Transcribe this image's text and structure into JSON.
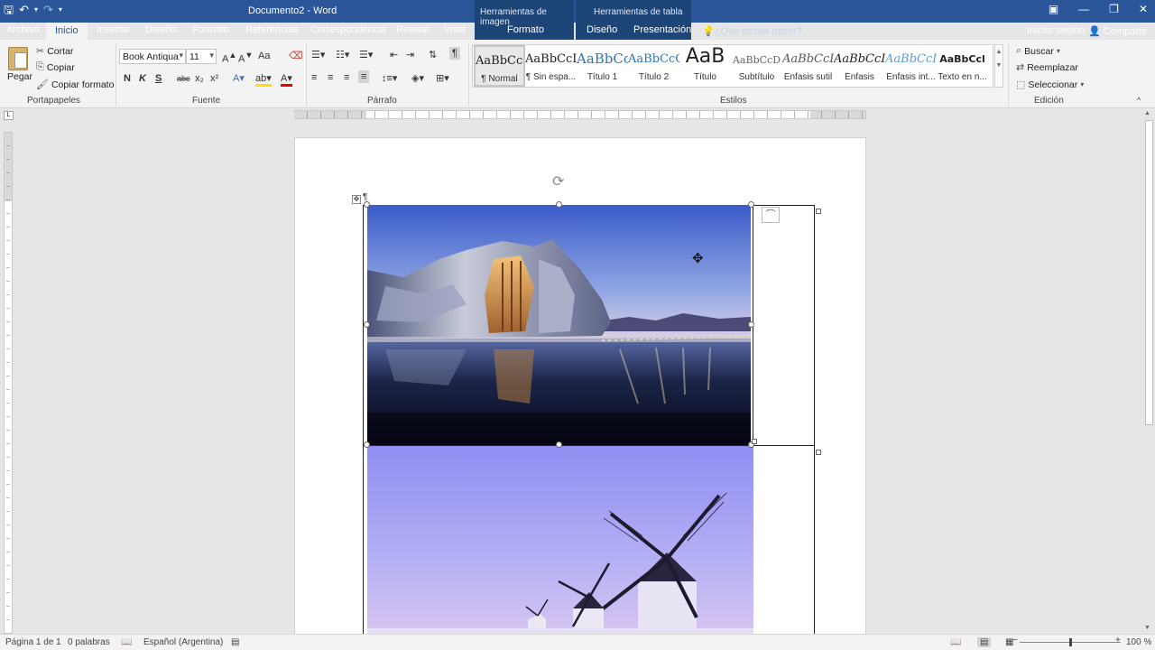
{
  "titlebar": {
    "title": "Documento2 - Word",
    "context_image": "Herramientas de imagen",
    "context_table": "Herramientas de tabla",
    "qat_icons": [
      "save-icon",
      "undo-icon",
      "redo-icon",
      "customize-icon"
    ]
  },
  "tabs": {
    "file": "Archivo",
    "home": "Inicio",
    "insert": "Insertar",
    "design": "Diseño",
    "format": "Formato",
    "references": "Referencias",
    "mailings": "Correspondencia",
    "review": "Revisar",
    "view": "Vista",
    "ctx_format": "Formato",
    "ctx_design": "Diseño",
    "ctx_layout": "Presentación",
    "tell_me": "¿Qué desea hacer?",
    "sign_in": "Iniciar sesión",
    "share": "Compartir"
  },
  "clipboard": {
    "paste": "Pegar",
    "cut": "Cortar",
    "copy": "Copiar",
    "format_painter": "Copiar formato",
    "label": "Portapapeles"
  },
  "font": {
    "family": "Book Antiqua",
    "size": "11",
    "case": "Aa",
    "bold": "N",
    "italic": "K",
    "underline": "S",
    "strike": "abc",
    "subscript": "x₂",
    "superscript": "x²",
    "label": "Fuente"
  },
  "paragraph": {
    "label": "Párrafo"
  },
  "styles": {
    "label": "Estilos",
    "items": [
      {
        "preview": "AaBbCcI",
        "name": "¶ Normal"
      },
      {
        "preview": "AaBbCcI",
        "name": "¶ Sin espa..."
      },
      {
        "preview": "AaBbCc",
        "name": "Título 1"
      },
      {
        "preview": "AaBbCcC",
        "name": "Título 2"
      },
      {
        "preview": "AaB",
        "name": "Título"
      },
      {
        "preview": "AaBbCcD",
        "name": "Subtítulo"
      },
      {
        "preview": "AaBbCcI",
        "name": "Énfasis sutil"
      },
      {
        "preview": "AaBbCcI",
        "name": "Énfasis"
      },
      {
        "preview": "AaBbCcI",
        "name": "Énfasis int..."
      },
      {
        "preview": "AaBbCcl",
        "name": "Texto en n..."
      }
    ]
  },
  "editing": {
    "find": "Buscar",
    "replace": "Reemplazar",
    "select": "Seleccionar",
    "label": "Edición"
  },
  "status": {
    "page": "Página 1 de 1",
    "words": "0 palabras",
    "language": "Español (Argentina)",
    "zoom": "100 %"
  },
  "colors": {
    "brand": "#2b579a",
    "ribbon": "#f3f3f3"
  }
}
